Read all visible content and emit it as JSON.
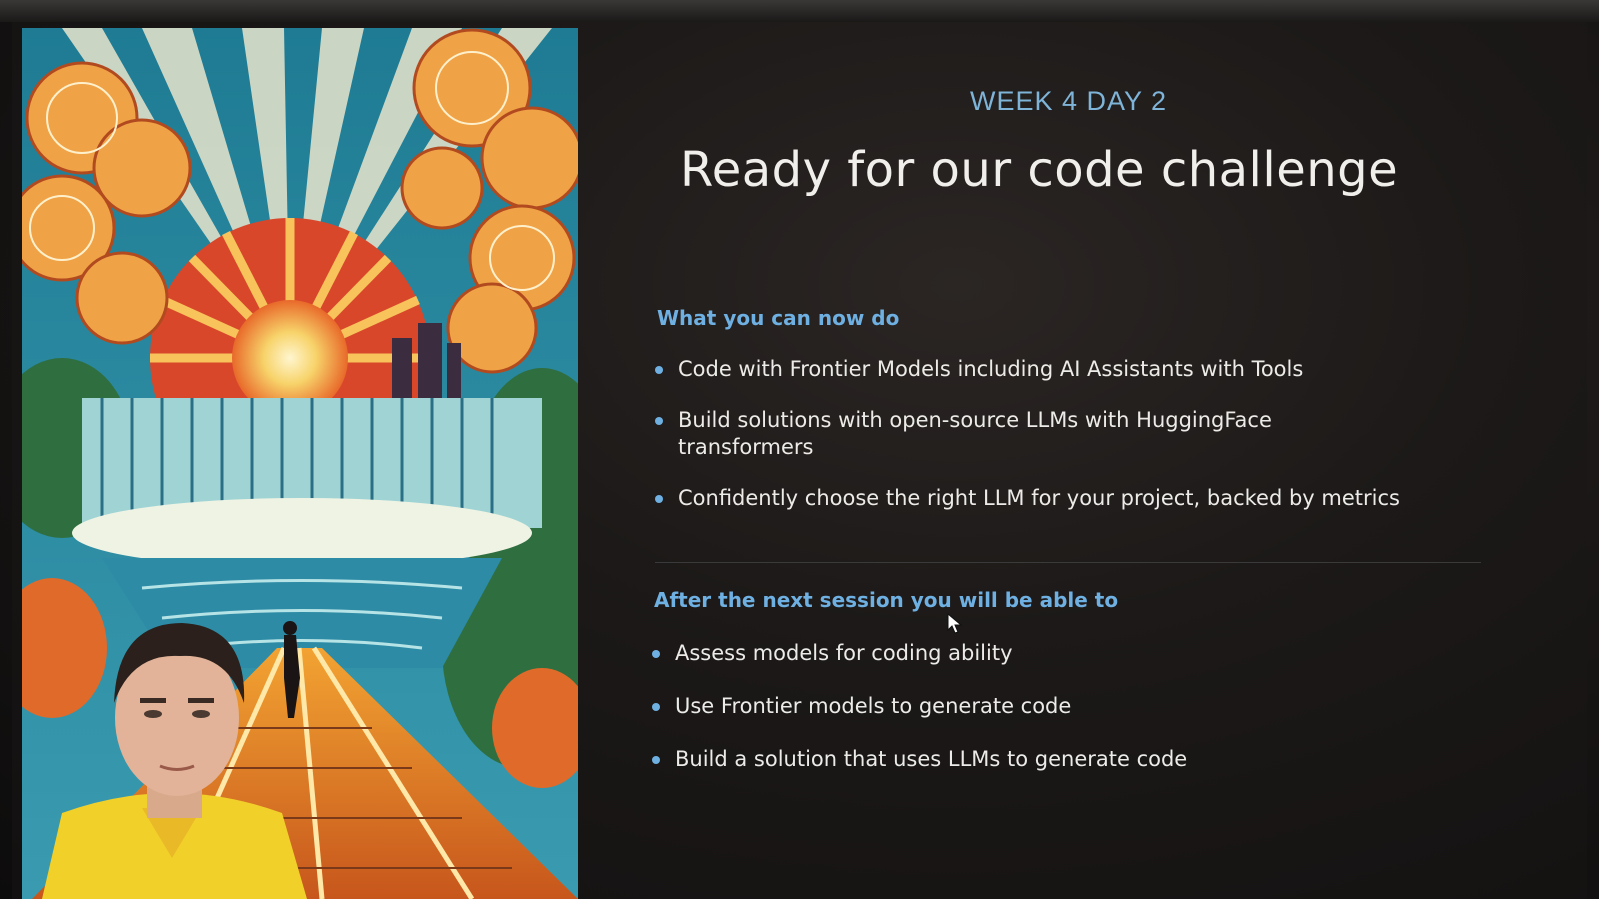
{
  "slide": {
    "kicker": "WEEK 4 DAY 2",
    "title": "Ready for our code challenge",
    "sections": [
      {
        "heading": "What you can now do",
        "items": [
          "Code with Frontier Models including AI Assistants with Tools",
          "Build solutions with open-source LLMs with HuggingFace transformers",
          "Confidently choose the right LLM for your project, backed by metrics"
        ]
      },
      {
        "heading": "After the next session you will be able to",
        "items": [
          "Assess models for coding ability",
          "Use Frontier models to generate code",
          "Build a solution that uses LLMs to generate code"
        ]
      }
    ]
  },
  "colors": {
    "accent": "#6fb0e2",
    "kicker": "#7fb4d9",
    "text": "#ecebe8",
    "background": "#1c1918"
  },
  "icons": {
    "cursor": "mouse-pointer-icon"
  }
}
